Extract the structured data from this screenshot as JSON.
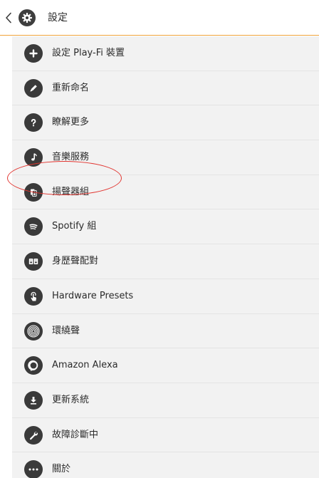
{
  "header": {
    "title": "設定",
    "back_icon": "chevron-left-icon",
    "settings_icon": "gear-icon"
  },
  "colors": {
    "accent_line": "#f0a33a",
    "list_background": "#f2f2f2",
    "icon_fill": "#3a3a3a",
    "highlight_circle": "#e1342f"
  },
  "menu": {
    "items": [
      {
        "label": "設定 Play-Fi 裝置",
        "icon": "plus-icon"
      },
      {
        "label": "重新命名",
        "icon": "pencil-icon"
      },
      {
        "label": "瞭解更多",
        "icon": "question-icon"
      },
      {
        "label": "音樂服務",
        "icon": "music-note-icon"
      },
      {
        "label": "揚聲器組",
        "icon": "speaker-group-icon"
      },
      {
        "label": "Spotify 組",
        "icon": "spotify-icon"
      },
      {
        "label": "身歷聲配對",
        "icon": "stereo-pair-icon"
      },
      {
        "label": "Hardware Presets",
        "icon": "hand-tap-icon"
      },
      {
        "label": "環繞聲",
        "icon": "surround-sound-icon"
      },
      {
        "label": "Amazon Alexa",
        "icon": "alexa-icon"
      },
      {
        "label": "更新系統",
        "icon": "download-icon"
      },
      {
        "label": "故障診斷中",
        "icon": "wrench-icon"
      },
      {
        "label": "關於",
        "icon": "ellipsis-icon"
      }
    ]
  }
}
